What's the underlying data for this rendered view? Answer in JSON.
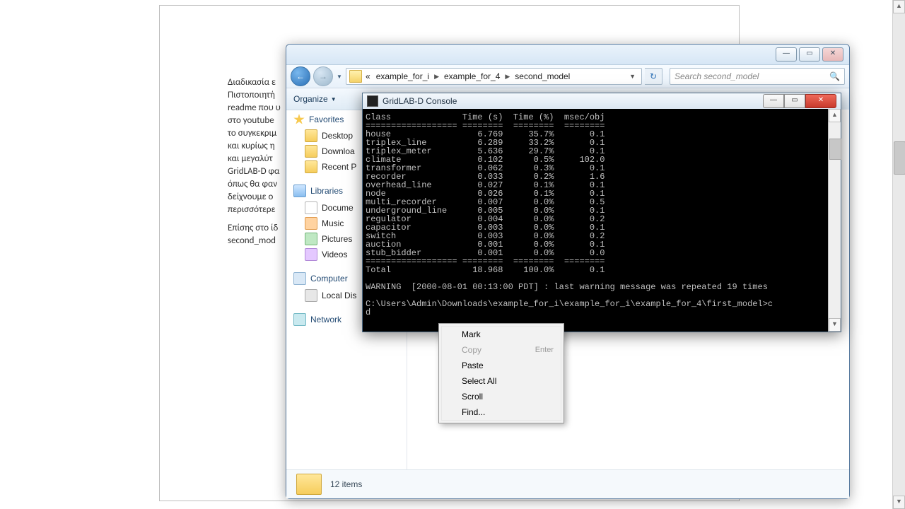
{
  "document": {
    "para1": "Διαδικασία ε\nΠιστοποιητή\nreadme που υ\nστο youtube\nτο συγκεκριμ\nκαι κυρίως η\nκαι μεγαλύτ\nGridLAB-D φα\nόπως θα φαν\nδείχνουμε  ο\nπερισσότερε",
    "para2": "Επίσης στο ίδ\nsecond_mod"
  },
  "explorer": {
    "win": {
      "min": "—",
      "max": "▭",
      "close": "✕"
    },
    "nav": {
      "back": "←",
      "fwd": "→"
    },
    "breadcrumb": {
      "pre": "«",
      "items": [
        "example_for_i",
        "example_for_4",
        "second_model"
      ]
    },
    "search_placeholder": "Search second_model",
    "toolbar": {
      "organize": "Organize"
    },
    "sidebar": {
      "favorites": {
        "head": "Favorites",
        "items": [
          "Desktop",
          "Downloa",
          "Recent P"
        ]
      },
      "libraries": {
        "head": "Libraries",
        "items": [
          "Docume",
          "Music",
          "Pictures",
          "Videos"
        ]
      },
      "computer": {
        "head": "Computer",
        "items": [
          "Local Dis"
        ]
      },
      "network": {
        "head": "Network"
      }
    },
    "status": "12 items"
  },
  "console": {
    "title": "GridLAB-D Console",
    "win": {
      "min": "—",
      "max": "▭",
      "close": "✕"
    },
    "header": "Class              Time (s)  Time (%)  msec/obj",
    "rule1": "================== ========  ========  ========",
    "rows": [
      {
        "c": "house",
        "t": "6.769",
        "p": "35.7%",
        "m": "0.1"
      },
      {
        "c": "triplex_line",
        "t": "6.289",
        "p": "33.2%",
        "m": "0.1"
      },
      {
        "c": "triplex_meter",
        "t": "5.636",
        "p": "29.7%",
        "m": "0.1"
      },
      {
        "c": "climate",
        "t": "0.102",
        "p": "0.5%",
        "m": "102.0"
      },
      {
        "c": "transformer",
        "t": "0.062",
        "p": "0.3%",
        "m": "0.1"
      },
      {
        "c": "recorder",
        "t": "0.033",
        "p": "0.2%",
        "m": "1.6"
      },
      {
        "c": "overhead_line",
        "t": "0.027",
        "p": "0.1%",
        "m": "0.1"
      },
      {
        "c": "node",
        "t": "0.026",
        "p": "0.1%",
        "m": "0.1"
      },
      {
        "c": "multi_recorder",
        "t": "0.007",
        "p": "0.0%",
        "m": "0.5"
      },
      {
        "c": "underground_line",
        "t": "0.005",
        "p": "0.0%",
        "m": "0.1"
      },
      {
        "c": "regulator",
        "t": "0.004",
        "p": "0.0%",
        "m": "0.2"
      },
      {
        "c": "capacitor",
        "t": "0.003",
        "p": "0.0%",
        "m": "0.1"
      },
      {
        "c": "switch",
        "t": "0.003",
        "p": "0.0%",
        "m": "0.2"
      },
      {
        "c": "auction",
        "t": "0.001",
        "p": "0.0%",
        "m": "0.1"
      },
      {
        "c": "stub_bidder",
        "t": "0.001",
        "p": "0.0%",
        "m": "0.0"
      }
    ],
    "rule2": "================== ========  ========  ========",
    "total": {
      "c": "Total",
      "t": "18.968",
      "p": "100.0%",
      "m": "0.1"
    },
    "warning": "WARNING  [2000-08-01 00:13:00 PDT] : last warning message was repeated 19 times",
    "prompt": "C:\\Users\\Admin\\Downloads\\example_for_i\\example_for_i\\example_for_4\\first_model>c",
    "prompt2": "d"
  },
  "context_menu": {
    "items": [
      {
        "label": "Mark",
        "disabled": false,
        "accel": ""
      },
      {
        "label": "Copy",
        "disabled": true,
        "accel": "Enter"
      },
      {
        "label": "Paste",
        "disabled": false,
        "accel": ""
      },
      {
        "label": "Select All",
        "disabled": false,
        "accel": ""
      },
      {
        "label": "Scroll",
        "disabled": false,
        "accel": ""
      },
      {
        "label": "Find...",
        "disabled": false,
        "accel": ""
      }
    ]
  }
}
